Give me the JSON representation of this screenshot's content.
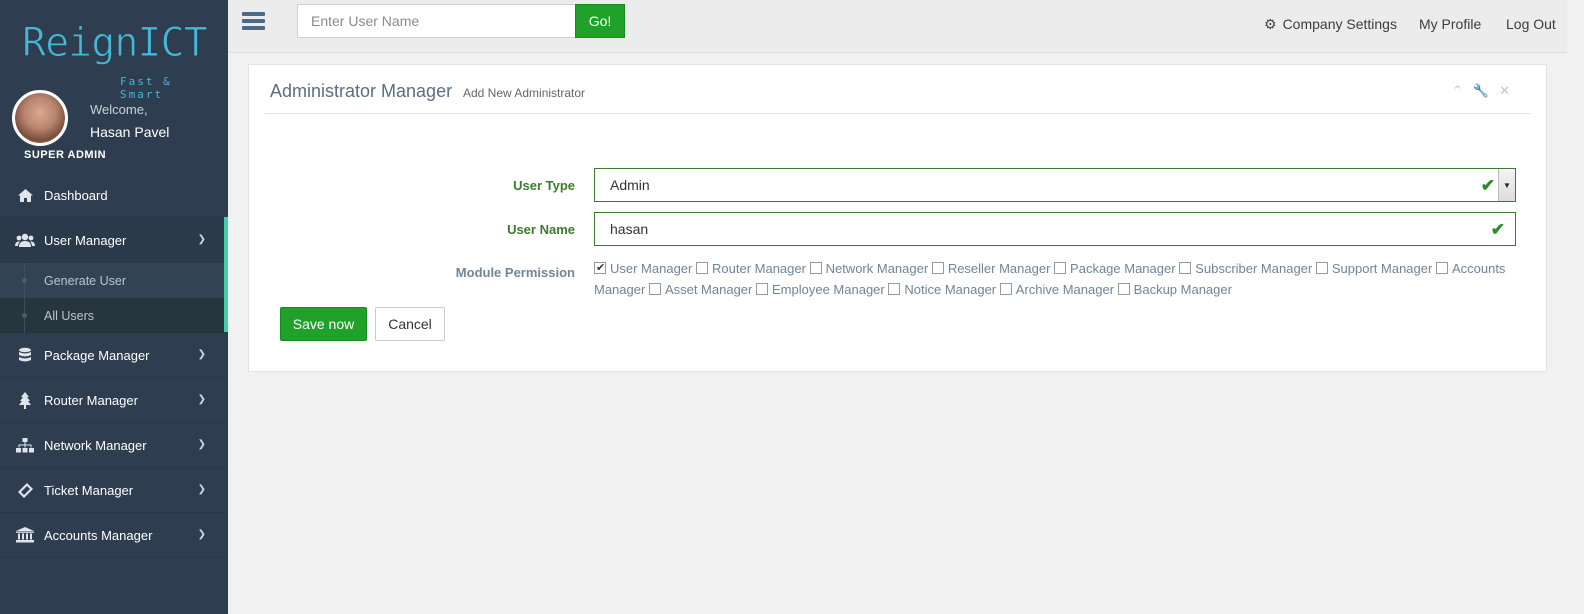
{
  "brand": {
    "logo_text": "ReignICT",
    "logo_tagline": "Fast & Smart",
    "accent": "#45b8d6"
  },
  "user_panel": {
    "welcome": "Welcome,",
    "name": "Hasan Pavel",
    "role": "SUPER ADMIN"
  },
  "sidebar": {
    "items": [
      {
        "label": "Dashboard",
        "icon": "home-icon"
      },
      {
        "label": "User Manager",
        "icon": "users-icon",
        "expanded": true,
        "children": [
          {
            "label": "Generate User",
            "active": true
          },
          {
            "label": "All Users"
          }
        ]
      },
      {
        "label": "Package Manager",
        "icon": "database-icon"
      },
      {
        "label": "Router Manager",
        "icon": "tree-icon"
      },
      {
        "label": "Network Manager",
        "icon": "sitemap-icon"
      },
      {
        "label": "Ticket Manager",
        "icon": "ticket-icon"
      },
      {
        "label": "Accounts Manager",
        "icon": "bank-icon"
      }
    ],
    "active_accent": "#3fcfa9"
  },
  "topbar": {
    "search": {
      "placeholder": "Enter User Name",
      "value": ""
    },
    "go_label": "Go!",
    "links": {
      "company_settings": "Company Settings",
      "my_profile": "My Profile",
      "logout": "Log Out"
    }
  },
  "panel": {
    "title": "Administrator Manager",
    "subtitle": "Add New Administrator",
    "form": {
      "user_type_label": "User Type",
      "user_type_value": "Admin",
      "user_name_label": "User Name",
      "user_name_value": "hasan",
      "module_permission_label": "Module Permission",
      "permissions": [
        {
          "label": "User Manager",
          "checked": true
        },
        {
          "label": "Router Manager",
          "checked": false
        },
        {
          "label": "Network Manager",
          "checked": false
        },
        {
          "label": "Reseller Manager",
          "checked": false
        },
        {
          "label": "Package Manager",
          "checked": false
        },
        {
          "label": "Subscriber Manager",
          "checked": false
        },
        {
          "label": "Support Manager",
          "checked": false
        },
        {
          "label": "Accounts Manager",
          "checked": false
        },
        {
          "label": "Asset Manager",
          "checked": false
        },
        {
          "label": "Employee Manager",
          "checked": false
        },
        {
          "label": "Notice Manager",
          "checked": false
        },
        {
          "label": "Archive Manager",
          "checked": false
        },
        {
          "label": "Backup Manager",
          "checked": false
        }
      ]
    },
    "save_label": "Save now",
    "cancel_label": "Cancel"
  },
  "colors": {
    "primary_green": "#1fa12a",
    "valid_green": "#3d7b2c",
    "sidebar_bg": "#2e3d4f"
  }
}
